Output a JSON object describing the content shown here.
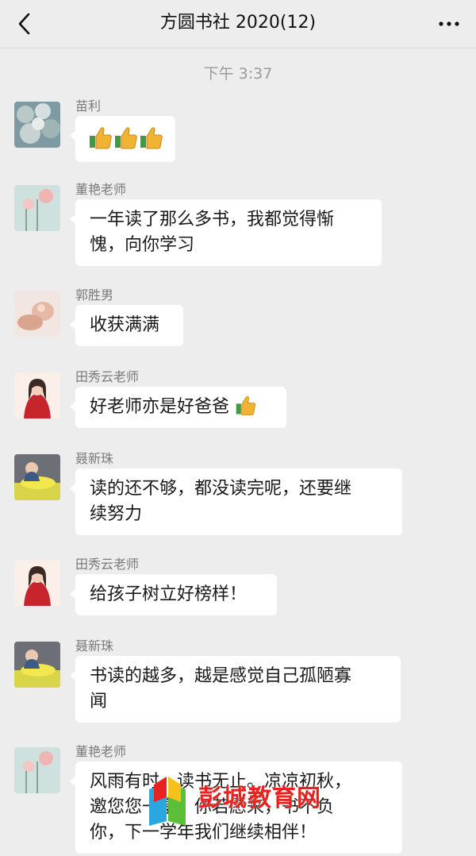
{
  "header": {
    "back_icon": "chevron-left-icon",
    "title": "方圆书社 2020(12)",
    "more_icon": "more-dots-icon"
  },
  "timestamp": "下午 3:37",
  "messages": [
    {
      "sender": "苗利",
      "text": "",
      "emoji_count": 3
    },
    {
      "sender": "董艳老师",
      "lines": [
        "一年读了那么多书，我都觉得惭",
        "愧，向你学习"
      ]
    },
    {
      "sender": "郭胜男",
      "lines": [
        "收获满满"
      ]
    },
    {
      "sender": "田秀云老师",
      "lines": [
        "好老师亦是好爸爸"
      ],
      "trailing_emoji": "thumbs-up-icon"
    },
    {
      "sender": "聂新珠",
      "lines": [
        "读的还不够，都没读完呢，还要继",
        "续努力"
      ]
    },
    {
      "sender": "田秀云老师",
      "lines": [
        "给孩子树立好榜样！"
      ]
    },
    {
      "sender": "聂新珠",
      "lines": [
        "书读的越多，越是感觉自己孤陋寡",
        "闻"
      ]
    },
    {
      "sender": "董艳老师",
      "lines": [
        "风雨有时，读书无止。凉凉初秋，",
        "邀您您一享。你若愿来，书不负",
        "你，下一学年我们继续相伴！"
      ]
    }
  ],
  "watermark": {
    "text": "彭城教育网"
  },
  "colors": {
    "background": "#ededed",
    "bubble": "#ffffff",
    "watermark": "#e8231f"
  }
}
